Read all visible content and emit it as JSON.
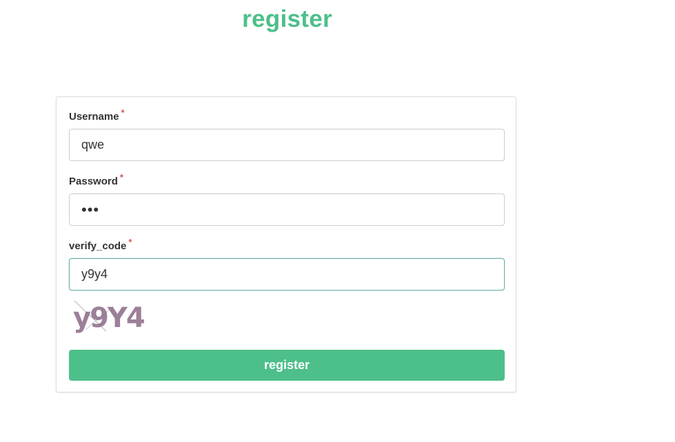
{
  "page": {
    "title": "register"
  },
  "form": {
    "username": {
      "label": "Username",
      "required_mark": "*",
      "value": "qwe"
    },
    "password": {
      "label": "Password",
      "required_mark": "*",
      "value": "•••"
    },
    "verify_code": {
      "label": "verify_code",
      "required_mark": "*",
      "value": "y9y4"
    },
    "captcha_text": "y9Y4",
    "submit_label": "register"
  },
  "colors": {
    "accent": "#4dbf8a",
    "required": "#d9534f",
    "focus_border": "#66afa9"
  }
}
